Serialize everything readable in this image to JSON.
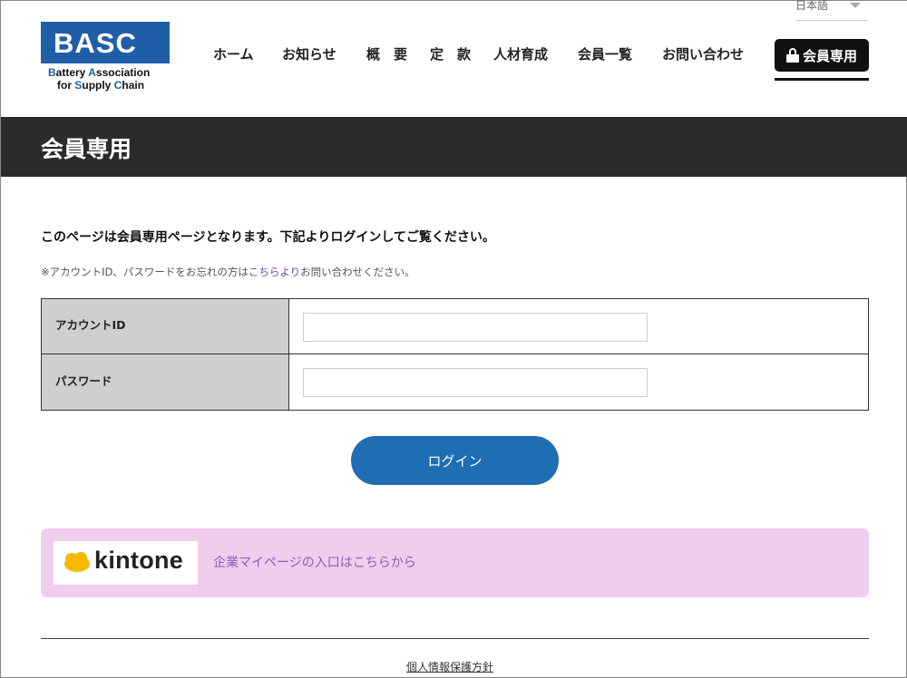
{
  "header": {
    "logo": {
      "main": "BASC",
      "sub_line1": [
        "B",
        "attery ",
        "A",
        "ssociation"
      ],
      "sub_line2": [
        "for ",
        "S",
        "upply ",
        "C",
        "hain"
      ]
    },
    "language": "日本語",
    "nav": [
      "ホーム",
      "お知らせ",
      "概　要",
      "定　款",
      "人材育成",
      "会員一覧",
      "お問い合わせ"
    ],
    "member_button": "会員専用"
  },
  "title_band": {
    "title": "会員専用"
  },
  "main": {
    "intro": "このページは会員専用ページとなります。下記よりログインしてご覧ください。",
    "note_prefix": "※アカウントID、パスワードをお忘れの方は",
    "note_link": "こちらより",
    "note_suffix": "お問い合わせください。",
    "form": {
      "account_label": "アカウントID",
      "account_value": "",
      "password_label": "パスワード",
      "password_value": ""
    },
    "login_button": "ログイン"
  },
  "kintone": {
    "logo_text": "kintone",
    "link_text": "企業マイページの入口はこちらから"
  },
  "footer": {
    "privacy_link": "個人情報保護方針"
  },
  "colors": {
    "brand_blue": "#1f5fa8",
    "button_blue": "#1f6db3",
    "title_band": "#2b2b2b",
    "kintone_bg": "#f0cdec",
    "kintone_cloud": "#f6b800",
    "link_purple": "#8d5cc0"
  }
}
